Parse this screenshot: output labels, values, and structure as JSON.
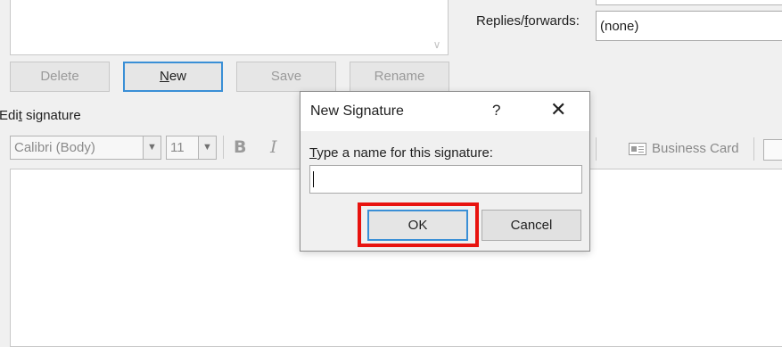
{
  "signature_editor": {
    "buttons": {
      "delete": "Delete",
      "new_prefix": "",
      "new_accel": "N",
      "new_rest": "ew",
      "save": "Save",
      "rename": "Rename"
    },
    "edit_label_prefix": "Edi",
    "edit_label_accel": "t",
    "edit_label_rest": " signature",
    "font_family": "Calibri (Body)",
    "font_size": "11",
    "bold_glyph": "B",
    "italic_glyph": "I",
    "business_card": "Business Card"
  },
  "defaults": {
    "replies_label_prefix": "Replies/",
    "replies_label_accel": "f",
    "replies_label_rest": "orwards:",
    "replies_value": "(none)"
  },
  "dialog": {
    "title": "New Signature",
    "help": "?",
    "close": "✕",
    "prompt_accel": "T",
    "prompt_rest": "ype a name for this signature:",
    "input_value": "",
    "ok": "OK",
    "cancel": "Cancel"
  },
  "icons": [
    "chevron-down-icon",
    "bold-icon",
    "italic-icon",
    "business-card-icon",
    "close-icon",
    "help-icon"
  ],
  "colors": {
    "highlight": "#e8130f",
    "focus_border": "#3a8fd6"
  }
}
